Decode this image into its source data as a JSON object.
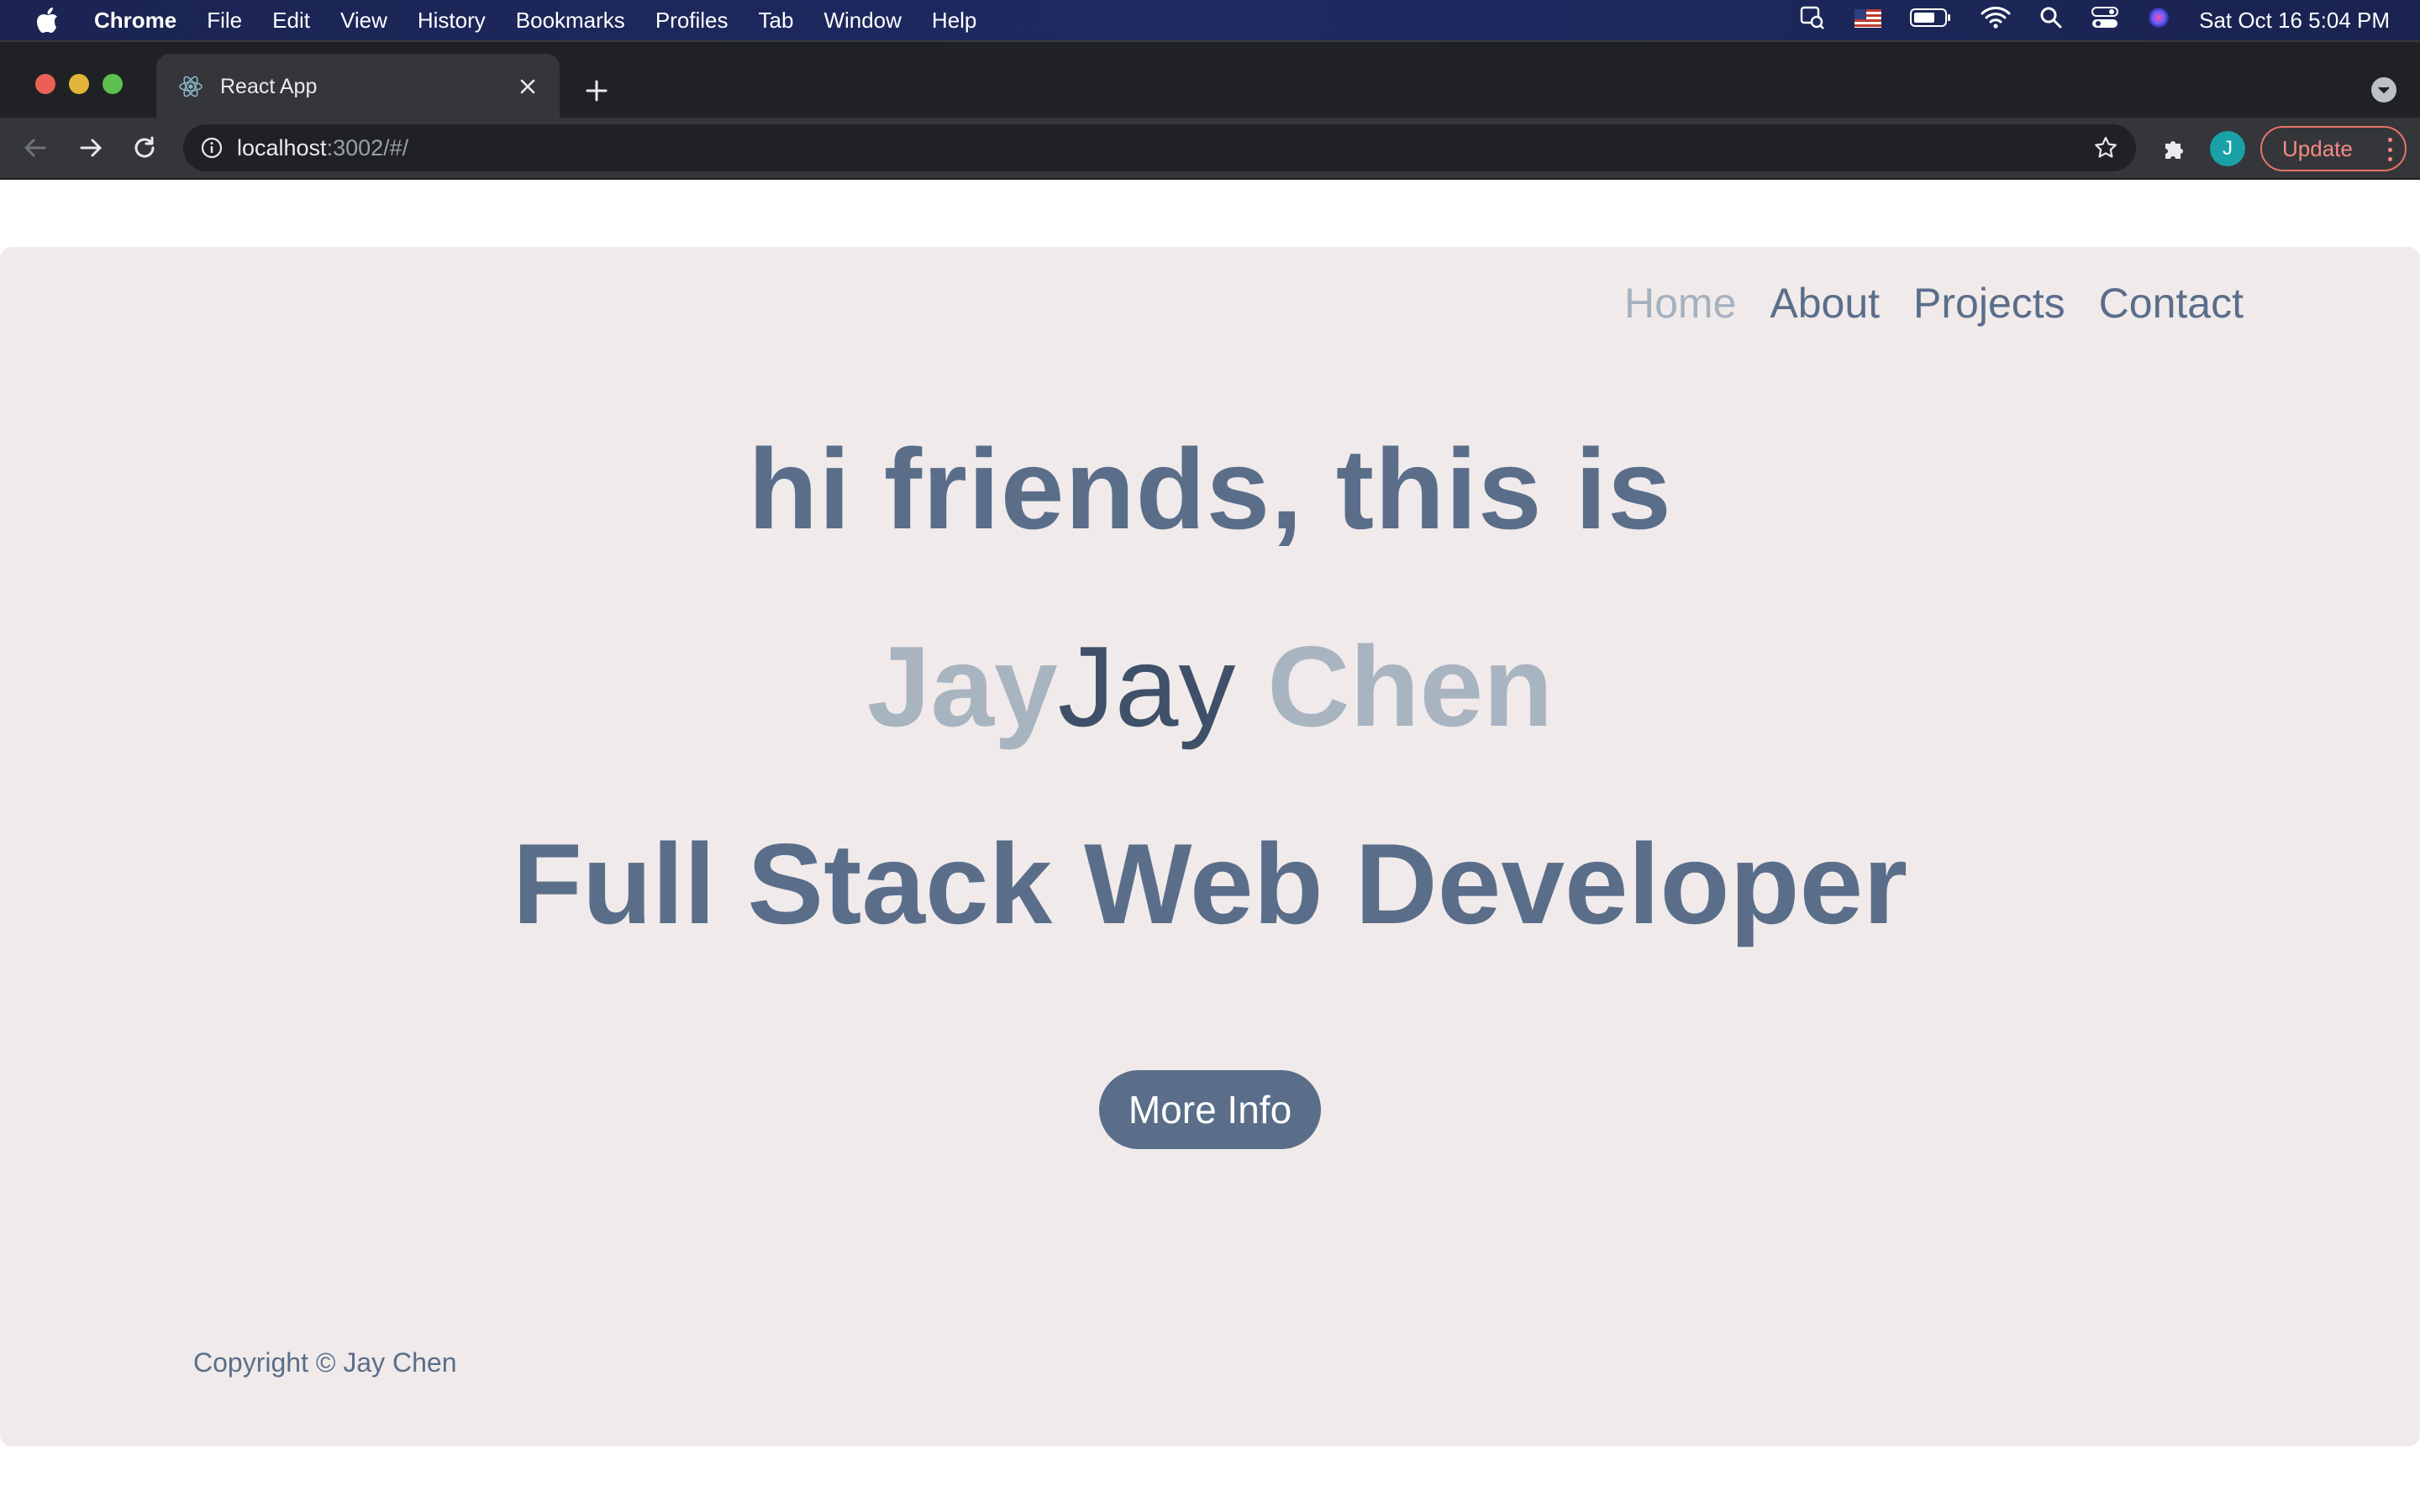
{
  "menubar": {
    "items": [
      "Chrome",
      "File",
      "Edit",
      "View",
      "History",
      "Bookmarks",
      "Profiles",
      "Tab",
      "Window",
      "Help"
    ],
    "clock": "Sat Oct 16  5:04 PM"
  },
  "browser": {
    "tab_title": "React App",
    "url_host": "localhost",
    "url_rest": ":3002/#/",
    "avatar_letter": "J",
    "update_label": "Update"
  },
  "nav": {
    "items": [
      "Home",
      "About",
      "Projects",
      "Contact"
    ],
    "active": "Home"
  },
  "hero": {
    "line1": "hi friends, this is",
    "line2_light": "Jay",
    "line2_dark": "Jay",
    "line2_tail": " Chen",
    "line3": "Full Stack Web Developer"
  },
  "cta": {
    "label": "More Info"
  },
  "footer": {
    "copyright": "Copyright © Jay Chen"
  },
  "colors": {
    "accent": "#5a6e8a",
    "muted": "#a9b4c1",
    "card_bg": "#f0eaea",
    "update_red": "#f28b82"
  }
}
